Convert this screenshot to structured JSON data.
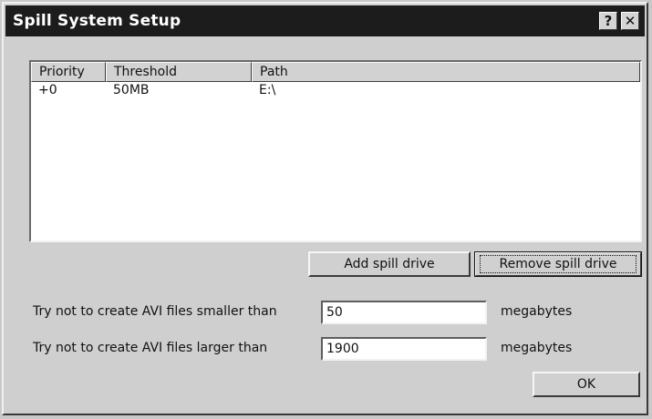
{
  "window": {
    "title": "Spill System Setup",
    "help_label": "?",
    "close_label": "✕"
  },
  "spill_list": {
    "columns": [
      "Priority",
      "Threshold",
      "Path"
    ],
    "rows": [
      {
        "priority": "+0",
        "threshold": "50MB",
        "path": "E:\\"
      }
    ]
  },
  "buttons": {
    "add_label": "Add spill drive",
    "remove_label": "Remove spill drive",
    "ok_label": "OK"
  },
  "limits": {
    "min_label": "Try not to create AVI files smaller than",
    "min_value": "50",
    "min_unit": "megabytes",
    "max_label": "Try not to create AVI files larger than",
    "max_value": "1900",
    "max_unit": "megabytes"
  }
}
